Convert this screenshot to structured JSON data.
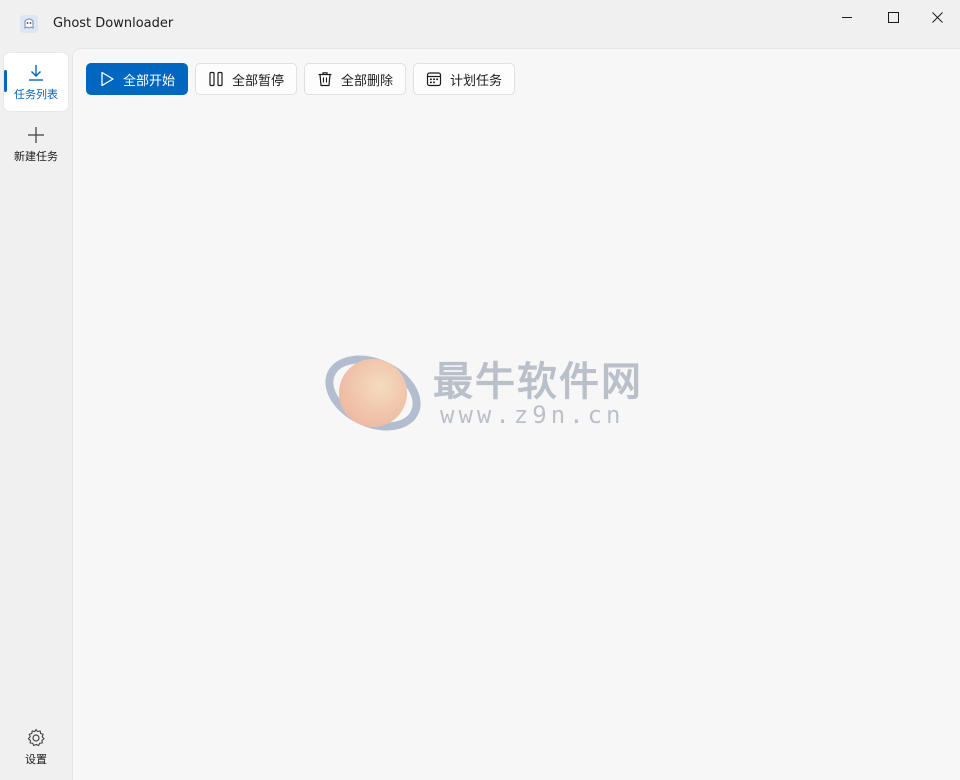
{
  "window": {
    "title": "Ghost Downloader",
    "controls": {
      "minimize": "minimize",
      "maximize": "maximize",
      "close": "close"
    }
  },
  "sidebar": {
    "items": [
      {
        "label": "任务列表",
        "icon": "download-icon",
        "selected": true
      },
      {
        "label": "新建任务",
        "icon": "plus-icon",
        "selected": false
      }
    ],
    "settings": {
      "label": "设置",
      "icon": "gear-icon"
    }
  },
  "toolbar": {
    "start_all": "全部开始",
    "pause_all": "全部暂停",
    "delete_all": "全部删除",
    "schedule": "计划任务"
  },
  "watermark": {
    "text": "最牛软件网",
    "url": "www.z9n.cn"
  },
  "colors": {
    "accent": "#0067c0",
    "background": "#f3f3f3",
    "content_bg": "#f7f7f7"
  }
}
